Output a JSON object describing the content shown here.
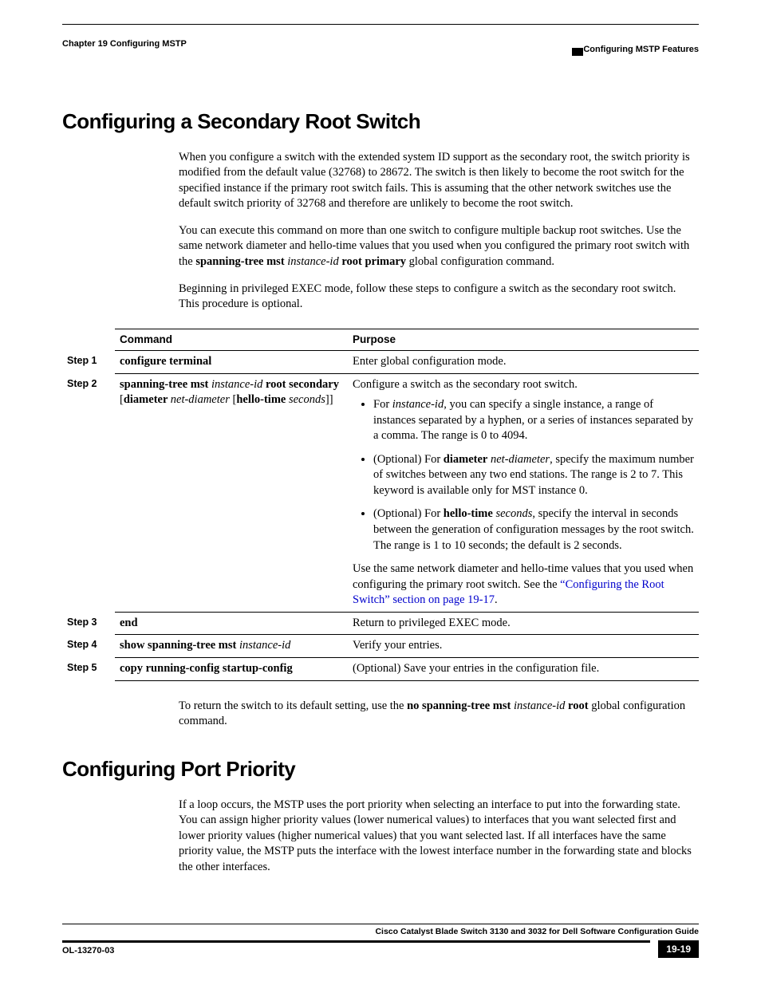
{
  "header": {
    "chapter": "Chapter 19      Configuring MSTP",
    "section": "Configuring MSTP Features"
  },
  "section1": {
    "title": "Configuring a Secondary Root Switch",
    "p1": "When you configure a switch with the extended system ID support as the secondary root, the switch priority is modified from the default value (32768) to 28672. The switch is then likely to become the root switch for the specified instance if the primary root switch fails. This is assuming that the other network switches use the default switch priority of 32768 and therefore are unlikely to become the root switch.",
    "p2_a": "You can execute this command on more than one switch to configure multiple backup root switches. Use the same network diameter and hello-time values that you used when you configured the primary root switch with the ",
    "p2_b": "spanning-tree mst",
    "p2_c": " instance-id ",
    "p2_d": "root primary",
    "p2_e": " global configuration command.",
    "p3": "Beginning in privileged EXEC mode, follow these steps to configure a switch as the secondary root switch. This procedure is optional.",
    "after_a": "To return the switch to its default setting, use the ",
    "after_b": "no spanning-tree mst",
    "after_c": " instance-id ",
    "after_d": "root",
    "after_e": " global configuration command."
  },
  "table": {
    "h1": "Command",
    "h2": "Purpose",
    "s1": "Step 1",
    "s2": "Step 2",
    "s3": "Step 3",
    "s4": "Step 4",
    "s5": "Step 5",
    "c1": "configure terminal",
    "c2_a": "spanning-tree mst ",
    "c2_b": "instance-id",
    "c2_c": " root secondary ",
    "c2_d": "[",
    "c2_e": "diameter ",
    "c2_f": "net-diameter",
    "c2_g": " [",
    "c2_h": "hello-time ",
    "c2_i": "seconds",
    "c2_j": "]]",
    "c3": "end",
    "c4_a": "show spanning-tree mst ",
    "c4_b": "instance-id",
    "c5": "copy running-config startup-config",
    "p1": "Enter global configuration mode.",
    "p2_intro": "Configure a switch as the secondary root switch.",
    "p2_b1_a": "For ",
    "p2_b1_b": "instance-id",
    "p2_b1_c": ", you can specify a single instance, a range of instances separated by a hyphen, or a series of instances separated by a comma. The range is 0 to 4094.",
    "p2_b2_a": "(Optional) For ",
    "p2_b2_b": "diameter",
    "p2_b2_c": " net-diameter",
    "p2_b2_d": ", specify the maximum number of switches between any two end stations. The range is 2 to 7. This keyword is available only for MST instance 0.",
    "p2_b3_a": "(Optional) For ",
    "p2_b3_b": "hello-time",
    "p2_b3_c": " seconds",
    "p2_b3_d": ", specify the interval in seconds between the generation of configuration messages by the root switch. The range is 1 to 10 seconds; the default is 2 seconds.",
    "p2_out_a": "Use the same network diameter and hello-time values that you used when configuring the primary root switch. See the ",
    "p2_out_link": "“Configuring the Root Switch” section on page 19-17",
    "p2_out_b": ".",
    "p3": "Return to privileged EXEC mode.",
    "p4": "Verify your entries.",
    "p5": "(Optional) Save your entries in the configuration file."
  },
  "section2": {
    "title": "Configuring Port Priority",
    "p1": "If a loop occurs, the MSTP uses the port priority when selecting an interface to put into the forwarding state. You can assign higher priority values (lower numerical values) to interfaces that you want selected first and lower priority values (higher numerical values) that you want selected last. If all interfaces have the same priority value, the MSTP puts the interface with the lowest interface number in the forwarding state and blocks the other interfaces."
  },
  "footer": {
    "guide": "Cisco Catalyst Blade Switch 3130 and 3032 for Dell Software Configuration Guide",
    "doc": "OL-13270-03",
    "page": "19-19"
  }
}
